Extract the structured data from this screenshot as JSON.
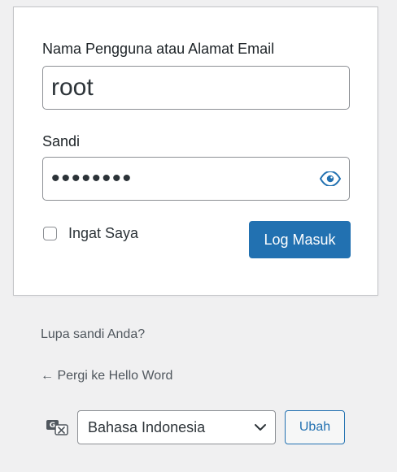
{
  "login": {
    "username_label": "Nama Pengguna atau Alamat Email",
    "username_value": "root",
    "password_label": "Sandi",
    "password_value": "password",
    "remember_label": "Ingat Saya",
    "submit_label": "Log Masuk"
  },
  "links": {
    "forgot": "Lupa sandi Anda?",
    "back": "← Pergi ke Hello Word"
  },
  "language": {
    "selected": "Bahasa Indonesia",
    "change_label": "Ubah"
  },
  "colors": {
    "background": "#f0f0f1",
    "accent": "#2271b1",
    "text": "#1d2327"
  },
  "icons": {
    "password_toggle": "eye-icon",
    "language": "translation-icon",
    "dropdown": "chevron-down-icon"
  }
}
